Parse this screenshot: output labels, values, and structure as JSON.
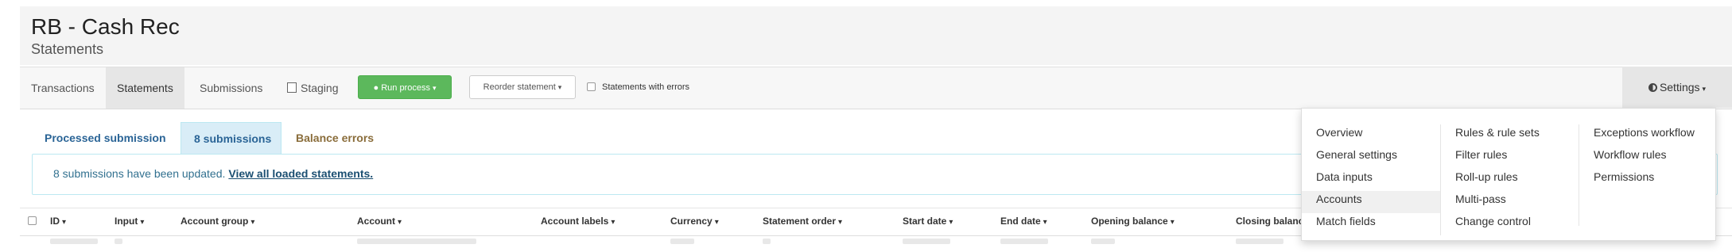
{
  "header": {
    "title": "RB - Cash Rec",
    "subtitle": "Statements"
  },
  "nav": {
    "tabs": [
      {
        "label": "Transactions"
      },
      {
        "label": "Statements",
        "active": true
      },
      {
        "label": "Submissions"
      },
      {
        "label": "Staging",
        "icon": "copy-icon"
      }
    ],
    "run_process": "Run process",
    "reorder": "Reorder statement",
    "statements_with_errors": "Statements with errors",
    "settings": "Settings"
  },
  "subtabs": [
    "Processed submission",
    "8 submissions",
    "Balance errors"
  ],
  "alert": {
    "text": "8 submissions have been updated.",
    "link": "View all loaded statements."
  },
  "table": {
    "columns": [
      "ID",
      "Input",
      "Account group",
      "Account",
      "Account labels",
      "Currency",
      "Statement order",
      "Start date",
      "End date",
      "Opening balance",
      "Closing balance"
    ]
  },
  "settings_menu": {
    "columns": [
      [
        "Overview",
        "General settings",
        "Data inputs",
        "Accounts",
        "Match fields"
      ],
      [
        "Rules & rule sets",
        "Filter rules",
        "Roll-up rules",
        "Multi-pass",
        "Change control"
      ],
      [
        "Exceptions workflow",
        "Workflow rules",
        "Permissions"
      ]
    ],
    "active_item": "Accounts"
  },
  "colors": {
    "success": "#5cb85c",
    "info_bg": "#d9edf7",
    "link": "#2a6496",
    "warning_text": "#8a6d3b"
  }
}
